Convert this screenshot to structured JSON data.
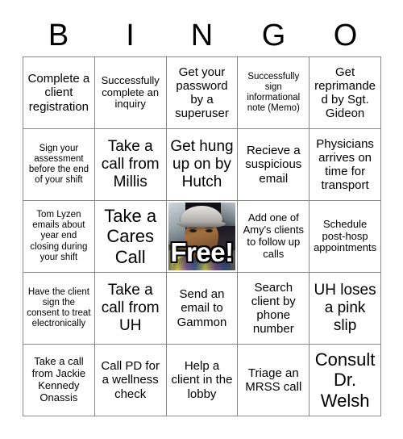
{
  "card": {
    "headers": [
      "B",
      "I",
      "N",
      "G",
      "O"
    ],
    "free_space": {
      "label": "Free!",
      "image_name": "free-space-photo"
    },
    "rows": [
      [
        {
          "text": "Complete a client registration",
          "size": "t-md"
        },
        {
          "text": "Successfully complete an inquiry",
          "size": "t-sm"
        },
        {
          "text": "Get your password by a superuser",
          "size": "t-md"
        },
        {
          "text": "Successfully sign informational note (Memo)",
          "size": "t-xs"
        },
        {
          "text": "Get reprimanded by Sgt. Gideon",
          "size": "t-md"
        }
      ],
      [
        {
          "text": "Sign your assessment before the end of your shift",
          "size": "t-xs"
        },
        {
          "text": "Take a call from Millis",
          "size": "t-lg"
        },
        {
          "text": "Get hung up on by Hutch",
          "size": "t-lg"
        },
        {
          "text": "Recieve a suspicious email",
          "size": "t-md"
        },
        {
          "text": "Physicians arrives on time for transport",
          "size": "t-md"
        }
      ],
      [
        {
          "text": "Tom Lyzen emails about year end closing during your shift",
          "size": "t-xs"
        },
        {
          "text": "Take a Cares Call",
          "size": "t-xl"
        },
        {
          "text": "",
          "size": "free"
        },
        {
          "text": "Add one of Amy's clients to follow up calls",
          "size": "t-sm"
        },
        {
          "text": "Schedule post-hosp appointments",
          "size": "t-sm"
        }
      ],
      [
        {
          "text": "Have the client sign the consent to treat electronically",
          "size": "t-xs"
        },
        {
          "text": "Take a call from UH",
          "size": "t-lg"
        },
        {
          "text": "Send an email to Gammon",
          "size": "t-md"
        },
        {
          "text": "Search client by phone number",
          "size": "t-md"
        },
        {
          "text": "UH loses a pink slip",
          "size": "t-lg"
        }
      ],
      [
        {
          "text": "Take a call from Jackie Kennedy Onassis",
          "size": "t-sm"
        },
        {
          "text": "Call PD for a wellness check",
          "size": "t-md"
        },
        {
          "text": "Help a client in the lobby",
          "size": "t-md"
        },
        {
          "text": "Triage an MRSS call",
          "size": "t-md"
        },
        {
          "text": "Consult Dr. Welsh",
          "size": "t-xl"
        }
      ]
    ]
  },
  "colors": {
    "background": "#ffffff",
    "text": "#000000",
    "grid_line": "#888888",
    "free_label_fill": "#ffffff",
    "free_label_outline": "#000000"
  }
}
